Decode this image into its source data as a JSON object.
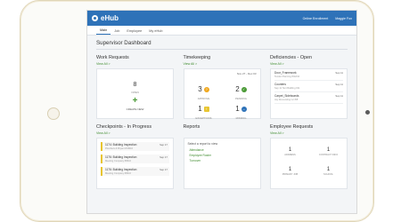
{
  "app": {
    "logo_text": "eHub"
  },
  "topbar": {
    "location": "Online Enrollment",
    "user": "Maggie Fox"
  },
  "tabs": [
    {
      "label": "Main",
      "active": true
    },
    {
      "label": "Job",
      "active": false
    },
    {
      "label": "Employee",
      "active": false
    },
    {
      "label": "My eHub",
      "active": false
    }
  ],
  "page_title": "Supervisor Dashboard",
  "view_all": "View All >",
  "work_requests": {
    "title": "Work Requests",
    "open_count": "8",
    "open_label": "OPEN",
    "create_label": "CREATE NEW"
  },
  "timekeeping": {
    "title": "Timekeeping",
    "date_range": "Nov 27 - Dec 03",
    "cells": [
      {
        "value": "3",
        "label": "APPROVE",
        "icon": "question-icon",
        "color": "#f0a81e"
      },
      {
        "value": "2",
        "label": "PENDING",
        "icon": "check-icon",
        "color": "#4a9a36"
      },
      {
        "value": "1",
        "label": "EXCEPTIONS",
        "icon": "warning-icon",
        "color": "#e8c531"
      },
      {
        "value": "1",
        "label": "MISSING",
        "icon": "minus-icon",
        "color": "#2e72b8"
      }
    ]
  },
  "deficiencies": {
    "title": "Deficiencies - Open",
    "items": [
      {
        "name": "Door_Framework",
        "sub": "Tender Planning 8/22/16",
        "date": "Sep 11"
      },
      {
        "name": "Counters",
        "sub": "Sep 11 Tent Building #11",
        "date": "Sep 11"
      },
      {
        "name": "Carpet_Sideboards",
        "sub": "Jay Renovating inc 8/8",
        "date": "Sep 11"
      }
    ]
  },
  "checkpoints": {
    "title": "Checkpoints - In Progress",
    "items": [
      {
        "name": "1174: Building Inspection",
        "sub": "Plumbers & Bryant 8/18/16",
        "date": "Sep 17"
      },
      {
        "name": "1176: Building Inspection",
        "sub": "Meeting Company 8/8/16",
        "date": "Sep 17"
      },
      {
        "name": "1176: Building Inspection",
        "sub": "Meeting Company 8/8/16",
        "date": "Sep 17"
      }
    ]
  },
  "reports": {
    "title": "Reports",
    "prompt": "Select a report to view",
    "links": [
      "Attendance",
      "Employee Roster",
      "Turnover"
    ]
  },
  "employee_requests": {
    "title": "Employee Requests",
    "cells": [
      {
        "value": "1",
        "label": "ADDRESS"
      },
      {
        "value": "1",
        "label": "CONTRACT INFO"
      },
      {
        "value": "1",
        "label": "PRIMARY JOB"
      },
      {
        "value": "1",
        "label": "SCHOOL"
      }
    ]
  },
  "colors": {
    "brand": "#2e72b8",
    "link": "#3f8b2e",
    "accent": "#e8c531"
  }
}
